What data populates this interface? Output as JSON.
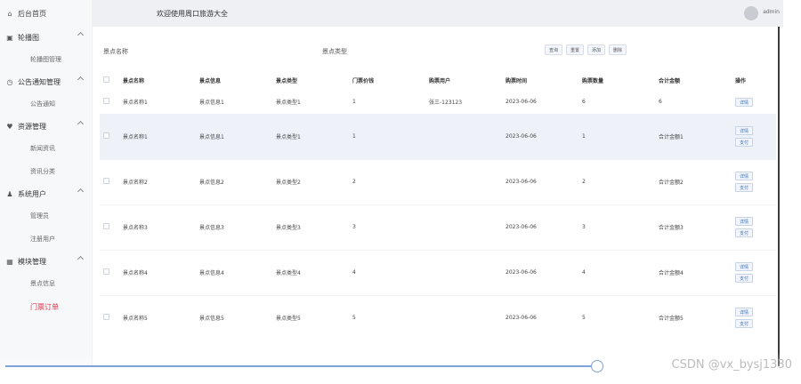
{
  "sidebar": {
    "home": "后台首页",
    "groups": [
      {
        "label": "轮播图",
        "icon": "image-icon",
        "children": [
          "轮播图管理"
        ]
      },
      {
        "label": "公告通知管理",
        "icon": "clock-icon",
        "children": [
          "公告通知"
        ]
      },
      {
        "label": "资源管理",
        "icon": "heart-icon",
        "children": [
          "新闻资讯",
          "资讯分类"
        ]
      },
      {
        "label": "系统用户",
        "icon": "user-icon",
        "children": [
          "管理员",
          "注册用户"
        ]
      },
      {
        "label": "模块管理",
        "icon": "grid-icon",
        "children": [
          "景点信息",
          "门票订单"
        ]
      }
    ],
    "active_child": "门票订单"
  },
  "header": {
    "welcome": "欢迎使用周口旅游大全",
    "user": "admin"
  },
  "filters": {
    "name_label": "景点名称",
    "type_label": "景点类型",
    "buttons": [
      "查询",
      "重置",
      "添加",
      "删除"
    ]
  },
  "table": {
    "columns": [
      "景点名称",
      "景点信息",
      "景点类型",
      "门票价钱",
      "购票用户",
      "购票时间",
      "购票数量",
      "合计金额",
      "操作"
    ],
    "rows": [
      {
        "name": "景点名称1",
        "info": "景点信息1",
        "type": "景点类型1",
        "price": "1",
        "user": "张三-123123",
        "time": "2023-06-06",
        "qty": "6",
        "total": "6",
        "actions": [
          "详情"
        ]
      },
      {
        "name": "景点名称1",
        "info": "景点信息1",
        "type": "景点类型1",
        "price": "1",
        "user": "",
        "time": "2023-06-06",
        "qty": "1",
        "total": "合计金额1",
        "actions": [
          "详情",
          "支付"
        ]
      },
      {
        "name": "景点名称2",
        "info": "景点信息2",
        "type": "景点类型2",
        "price": "2",
        "user": "",
        "time": "2023-06-06",
        "qty": "2",
        "total": "合计金额2",
        "actions": [
          "详情",
          "支付"
        ]
      },
      {
        "name": "景点名称3",
        "info": "景点信息3",
        "type": "景点类型3",
        "price": "3",
        "user": "",
        "time": "2023-06-06",
        "qty": "3",
        "total": "合计金额3",
        "actions": [
          "详情",
          "支付"
        ]
      },
      {
        "name": "景点名称4",
        "info": "景点信息4",
        "type": "景点类型4",
        "price": "4",
        "user": "",
        "time": "2023-06-06",
        "qty": "4",
        "total": "合计金额4",
        "actions": [
          "详情",
          "支付"
        ]
      },
      {
        "name": "景点名称5",
        "info": "景点信息5",
        "type": "景点类型5",
        "price": "5",
        "user": "",
        "time": "2023-06-06",
        "qty": "5",
        "total": "合计金额5",
        "actions": [
          "详情",
          "支付"
        ]
      }
    ]
  },
  "watermark": "CSDN @vx_bysj1330",
  "colors": {
    "accent": "#e0344a",
    "button": "#3a6fb0",
    "slider": "#7da3d8"
  }
}
